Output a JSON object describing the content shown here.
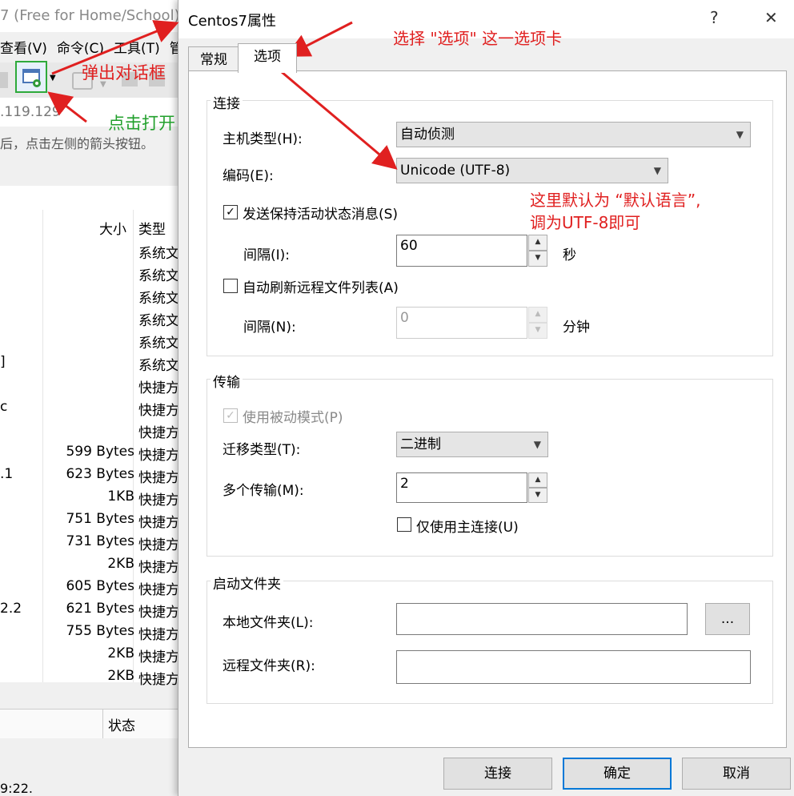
{
  "background_app": {
    "title": "7 (Free for Home/School)",
    "menu": [
      "查看(V)",
      "命令(C)",
      "工具(T)",
      "管"
    ],
    "address": ".119.129",
    "hint": "后，点击左侧的箭头按钮。",
    "columns": {
      "size": "大小",
      "type": "类型",
      "status": "状态"
    },
    "rows": [
      {
        "name": "",
        "size": "",
        "type": "系统文"
      },
      {
        "name": "",
        "size": "",
        "type": "系统文"
      },
      {
        "name": "",
        "size": "",
        "type": "系统文"
      },
      {
        "name": "",
        "size": "",
        "type": "系统文"
      },
      {
        "name": "",
        "size": "",
        "type": "系统文"
      },
      {
        "name": "]",
        "size": "",
        "type": "系统文"
      },
      {
        "name": "",
        "size": "",
        "type": "快捷方"
      },
      {
        "name": "c",
        "size": "",
        "type": "快捷方"
      },
      {
        "name": "",
        "size": "",
        "type": "快捷方"
      },
      {
        "name": "",
        "size": "599 Bytes",
        "type": "快捷方"
      },
      {
        "name": ".1",
        "size": "623 Bytes",
        "type": "快捷方"
      },
      {
        "name": "",
        "size": "1KB",
        "type": "快捷方"
      },
      {
        "name": "",
        "size": "751 Bytes",
        "type": "快捷方"
      },
      {
        "name": "",
        "size": "731 Bytes",
        "type": "快捷方"
      },
      {
        "name": "",
        "size": "2KB",
        "type": "快捷方"
      },
      {
        "name": "",
        "size": "605 Bytes",
        "type": "快捷方"
      },
      {
        "name": "2.2",
        "size": "621 Bytes",
        "type": "快捷方"
      },
      {
        "name": "",
        "size": "755 Bytes",
        "type": "快捷方"
      },
      {
        "name": "",
        "size": "2KB",
        "type": "快捷方"
      },
      {
        "name": "",
        "size": "2KB",
        "type": "快捷方"
      }
    ],
    "footer": "9:22."
  },
  "dialog": {
    "title": "Centos7属性",
    "help": "?",
    "close": "✕",
    "tabs": [
      {
        "label": "常规"
      },
      {
        "label": "选项"
      }
    ],
    "connection": {
      "group": "连接",
      "host_type_label": "主机类型(H):",
      "host_type_value": "自动侦测",
      "encoding_label": "编码(E):",
      "encoding_value": "Unicode (UTF-8)",
      "keepalive_label": "发送保持活动状态消息(S)",
      "keepalive_checked": true,
      "interval_label": "间隔(I):",
      "interval_value": "60",
      "interval_unit": "秒",
      "auto_refresh_label": "自动刷新远程文件列表(A)",
      "auto_refresh_checked": false,
      "refresh_interval_label": "间隔(N):",
      "refresh_interval_value": "0",
      "refresh_interval_unit": "分钟"
    },
    "transfer": {
      "group": "传输",
      "passive_label": "使用被动模式(P)",
      "passive_checked": true,
      "transfer_type_label": "迁移类型(T):",
      "transfer_type_value": "二进制",
      "multi_transfer_label": "多个传输(M):",
      "multi_transfer_value": "2",
      "main_conn_label": "仅使用主连接(U)",
      "main_conn_checked": false
    },
    "startup": {
      "group": "启动文件夹",
      "local_label": "本地文件夹(L):",
      "local_value": "",
      "browse": "...",
      "remote_label": "远程文件夹(R):",
      "remote_value": ""
    },
    "buttons": {
      "connect": "连接",
      "ok": "确定",
      "cancel": "取消"
    }
  },
  "annotations": {
    "popup": "弹出对话框",
    "click_open": "点击打开",
    "select_tab": "选择 \"选项\" 这一选项卡",
    "encoding_note_line1": "这里默认为 “默认语言”,",
    "encoding_note_line2": "调为UTF-8即可",
    "red": "#e02020",
    "green": "#22a02c",
    "highlight": "#2eaa3b"
  },
  "icons": {
    "toolbar_properties": "properties-gear-icon",
    "dropdown": "chevron-down-icon",
    "check": "check-icon"
  }
}
